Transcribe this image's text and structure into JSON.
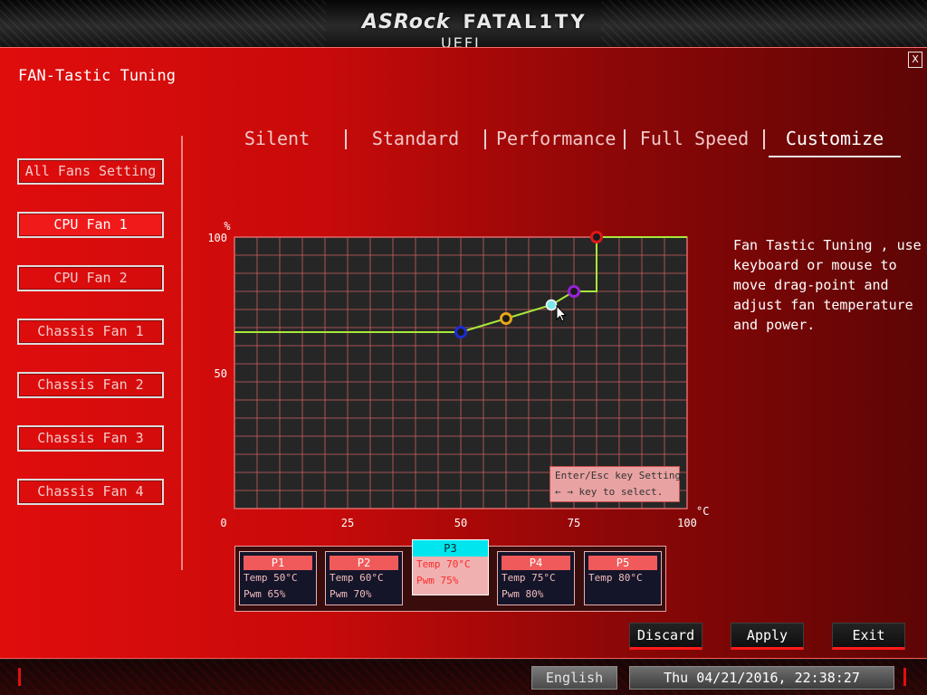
{
  "header": {
    "brand_primary": "ASRock",
    "brand_secondary": "FATAL1TY",
    "brand_sub": "UEFI"
  },
  "page": {
    "title": "FAN-Tastic Tuning",
    "close_label": "X"
  },
  "sidebar": {
    "items": [
      {
        "label": "All Fans Setting",
        "active": false
      },
      {
        "label": "CPU Fan 1",
        "active": true
      },
      {
        "label": "CPU Fan 2",
        "active": false
      },
      {
        "label": "Chassis Fan 1",
        "active": false
      },
      {
        "label": "Chassis Fan 2",
        "active": false
      },
      {
        "label": "Chassis Fan 3",
        "active": false
      },
      {
        "label": "Chassis Fan 4",
        "active": false
      }
    ]
  },
  "tabs": [
    {
      "label": "Silent",
      "active": false
    },
    {
      "label": "Standard",
      "active": false
    },
    {
      "label": "Performance",
      "active": false
    },
    {
      "label": "Full Speed",
      "active": false
    },
    {
      "label": "Customize",
      "active": true
    }
  ],
  "instructions": "Fan Tastic Tuning , use keyboard or mouse to move drag-point and adjust fan temperature and power.",
  "hint": {
    "line1": "Enter/Esc key Setting.",
    "line2": "← → key to select."
  },
  "chart_data": {
    "type": "line",
    "xlabel": "°C",
    "ylabel": "%",
    "xlim": [
      0,
      100
    ],
    "ylim": [
      0,
      100
    ],
    "x_ticks": [
      "0",
      "25",
      "50",
      "75",
      "100"
    ],
    "y_ticks": [
      "0",
      "50",
      "100"
    ],
    "grid": true,
    "points": [
      {
        "name": "P1",
        "temp": 50,
        "pwm": 65,
        "color": "#1d2bd8"
      },
      {
        "name": "P2",
        "temp": 60,
        "pwm": 70,
        "color": "#e8a51a"
      },
      {
        "name": "P3",
        "temp": 70,
        "pwm": 75,
        "color": "#7be8ec"
      },
      {
        "name": "P4",
        "temp": 75,
        "pwm": 80,
        "color": "#9a22d8"
      },
      {
        "name": "P5",
        "temp": 80,
        "pwm": 100,
        "color": "#e01818"
      }
    ],
    "curve_color": "#a8e83a",
    "selected_point": "P3"
  },
  "point_cards": [
    {
      "name": "P1",
      "temp": "Temp 50°C",
      "pwm": "Pwm  65%"
    },
    {
      "name": "P2",
      "temp": "Temp 60°C",
      "pwm": "Pwm  70%"
    },
    {
      "name": "P3",
      "temp": "Temp 70°C",
      "pwm": "Pwm  75%"
    },
    {
      "name": "P4",
      "temp": "Temp 75°C",
      "pwm": "Pwm  80%"
    },
    {
      "name": "P5",
      "temp": "Temp 80°C",
      "pwm": ""
    }
  ],
  "actions": {
    "discard": "Discard",
    "apply": "Apply",
    "exit": "Exit"
  },
  "footer": {
    "language": "English",
    "datetime": "Thu 04/21/2016, 22:38:27"
  },
  "colors": {
    "panel_red": "#e00d0d",
    "accent_red": "#ff1a1a",
    "selected_cyan": "#00e5ee"
  }
}
